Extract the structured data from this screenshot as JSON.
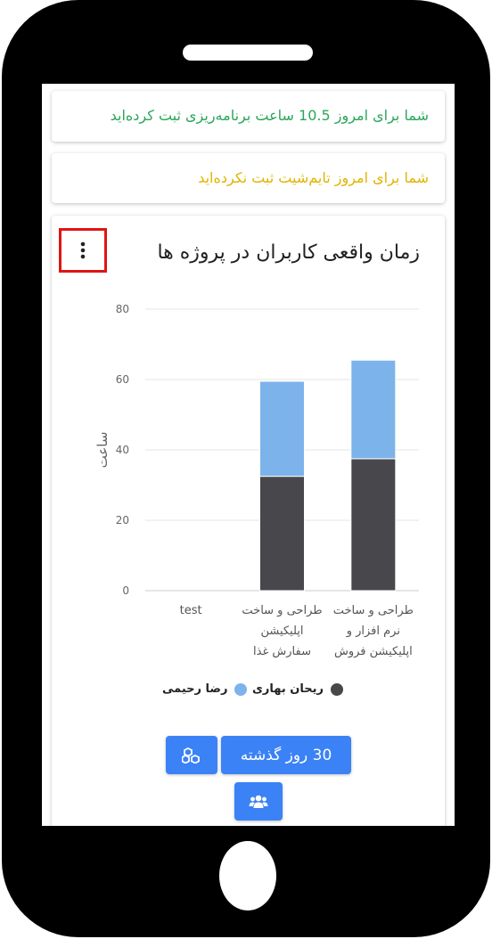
{
  "alerts": {
    "planned_hours": "شما برای امروز 10.5 ساعت برنامه‌ریزی ثبت کرده‌اید",
    "timesheet_missing": "شما برای امروز تایم‌شیت ثبت نکرده‌اید"
  },
  "colors": {
    "success": "#2aa65a",
    "warning": "#e0b400",
    "accent": "#3b82f6",
    "series_dark": "#47474c",
    "series_light": "#7cb3eb",
    "highlight": "#e01414"
  },
  "chart_card": {
    "title": "زمان واقعی کاربران در پروژه ها",
    "menu_icon": "kebab-vertical-icon"
  },
  "chart_data": {
    "type": "bar",
    "stacked": true,
    "categories": [
      "test",
      "طراحی و ساخت اپلیکیشن سفارش غذا",
      "طراحی و ساخت نرم افزار و اپلیکیشن فروش"
    ],
    "category_lines": [
      [
        "test"
      ],
      [
        "طراحی و ساخت",
        "اپلیکیشن",
        "سفارش غذا"
      ],
      [
        "طراحی و ساخت",
        "نرم افزار و",
        "اپلیکیشن فروش"
      ]
    ],
    "series": [
      {
        "name": "ریحان بهاری",
        "values": [
          0,
          32.5,
          37.5
        ],
        "color": "#47474c"
      },
      {
        "name": "رضا رحیمی",
        "values": [
          0,
          27,
          28
        ],
        "color": "#7cb3eb"
      }
    ],
    "ylabel": "ساعت",
    "ylim": [
      0,
      80
    ],
    "yticks": [
      0,
      20,
      40,
      60,
      80
    ],
    "grid": true,
    "legend_position": "bottom"
  },
  "buttons": {
    "range_label": "30 روز گذشته",
    "projects_icon": "cubes-icon",
    "users_icon": "users-icon"
  }
}
